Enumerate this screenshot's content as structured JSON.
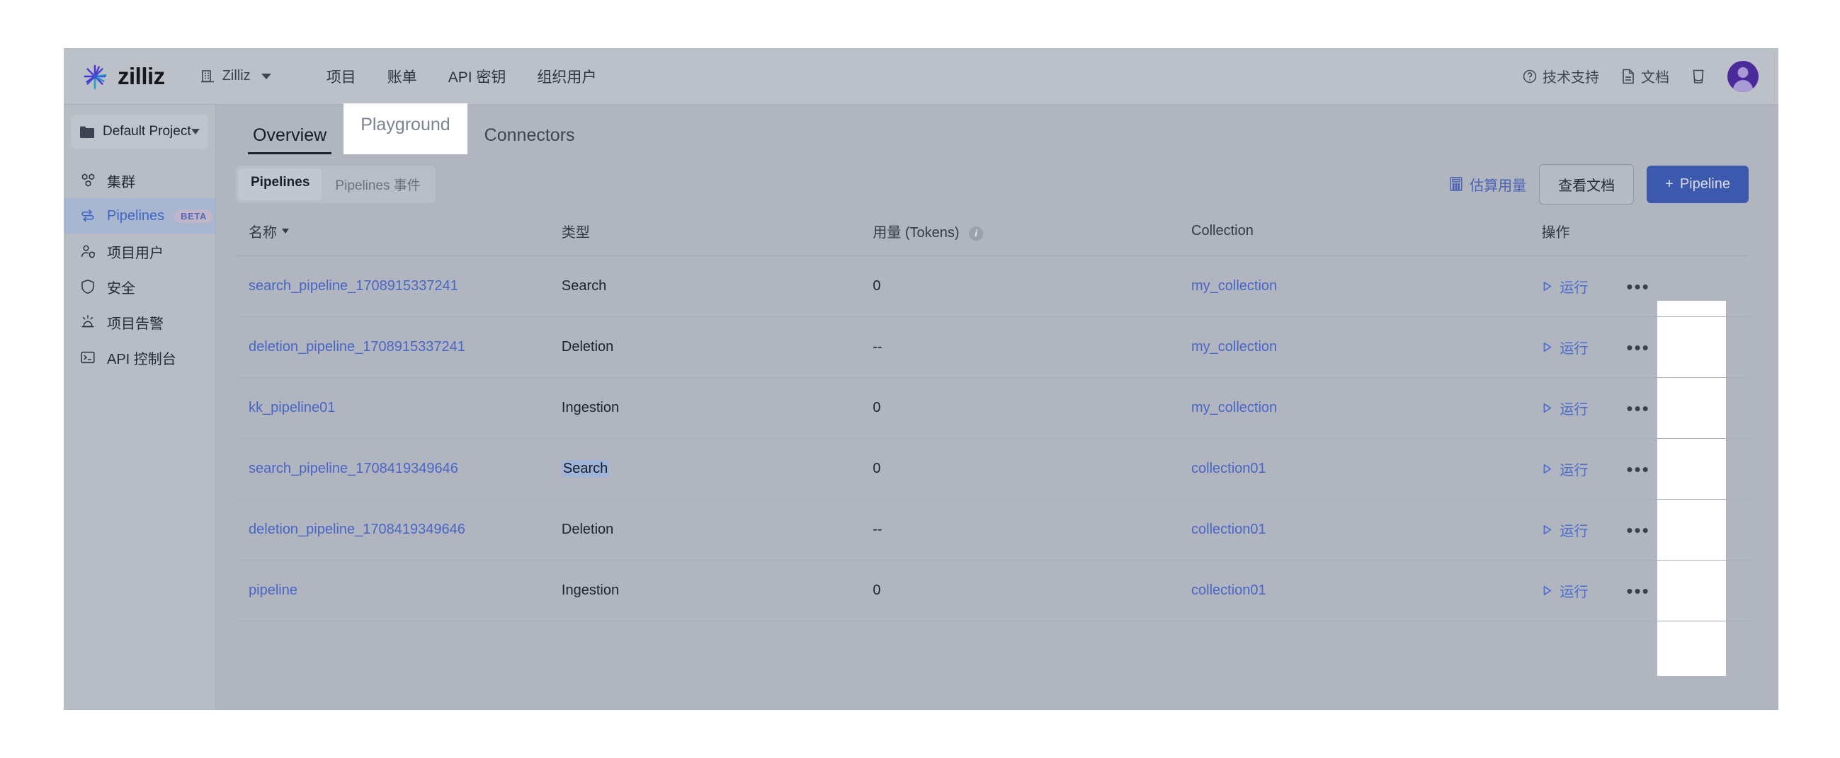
{
  "header": {
    "brand": "zilliz",
    "org_name": "Zilliz",
    "org_icon": "building-icon",
    "nav": [
      {
        "label": "项目",
        "name": "projects"
      },
      {
        "label": "账单",
        "name": "billing"
      },
      {
        "label": "API 密钥",
        "name": "api-keys"
      },
      {
        "label": "组织用户",
        "name": "org-users"
      }
    ],
    "support_label": "技术支持",
    "docs_label": "文档",
    "trash_icon": "trash-icon",
    "avatar_icon": "user-avatar"
  },
  "sidebar": {
    "project_name": "Default Project",
    "items": [
      {
        "label": "集群",
        "icon": "clusters-icon",
        "active": false,
        "badge": ""
      },
      {
        "label": "Pipelines",
        "icon": "pipelines-icon",
        "active": true,
        "badge": "BETA"
      },
      {
        "label": "项目用户",
        "icon": "project-users-icon",
        "active": false,
        "badge": ""
      },
      {
        "label": "安全",
        "icon": "shield-icon",
        "active": false,
        "badge": ""
      },
      {
        "label": "项目告警",
        "icon": "alert-icon",
        "active": false,
        "badge": ""
      },
      {
        "label": "API 控制台",
        "icon": "terminal-icon",
        "active": false,
        "badge": ""
      }
    ]
  },
  "tabs": [
    {
      "label": "Overview",
      "state": "active"
    },
    {
      "label": "Playground",
      "state": "hovered"
    },
    {
      "label": "Connectors",
      "state": "normal"
    }
  ],
  "segmented": [
    {
      "label": "Pipelines",
      "active": true
    },
    {
      "label": "Pipelines 事件",
      "active": false
    }
  ],
  "toolbar": {
    "estimate_label": "估算用量",
    "estimate_icon": "calculator-icon",
    "view_docs_label": "查看文档",
    "new_pipeline_label": "Pipeline",
    "new_pipeline_plus": "+"
  },
  "table": {
    "columns": [
      {
        "label": "名称",
        "sortable": true
      },
      {
        "label": "类型",
        "sortable": false
      },
      {
        "label": "用量 (Tokens)",
        "sortable": false,
        "info": "i"
      },
      {
        "label": "Collection",
        "sortable": false
      },
      {
        "label": "操作",
        "sortable": false
      }
    ],
    "run_label": "运行",
    "more_label": "•••",
    "rows": [
      {
        "name": "search_pipeline_1708915337241",
        "type": "Search",
        "type_selected": false,
        "usage": "0",
        "collection": "my_collection"
      },
      {
        "name": "deletion_pipeline_1708915337241",
        "type": "Deletion",
        "type_selected": false,
        "usage": "--",
        "collection": "my_collection"
      },
      {
        "name": "kk_pipeline01",
        "type": "Ingestion",
        "type_selected": false,
        "usage": "0",
        "collection": "my_collection"
      },
      {
        "name": "search_pipeline_1708419349646",
        "type": "Search",
        "type_selected": true,
        "usage": "0",
        "collection": "collection01"
      },
      {
        "name": "deletion_pipeline_1708419349646",
        "type": "Deletion",
        "type_selected": false,
        "usage": "--",
        "collection": "collection01"
      },
      {
        "name": "pipeline",
        "type": "Ingestion",
        "type_selected": false,
        "usage": "0",
        "collection": "collection01"
      }
    ]
  },
  "colors": {
    "accent_blue": "#4a66c4",
    "primary_button": "#3c59ad",
    "active_sidebar": "#a9b6d0",
    "selection": "#9fb4d8",
    "page_bg": "#b0b5bf"
  }
}
